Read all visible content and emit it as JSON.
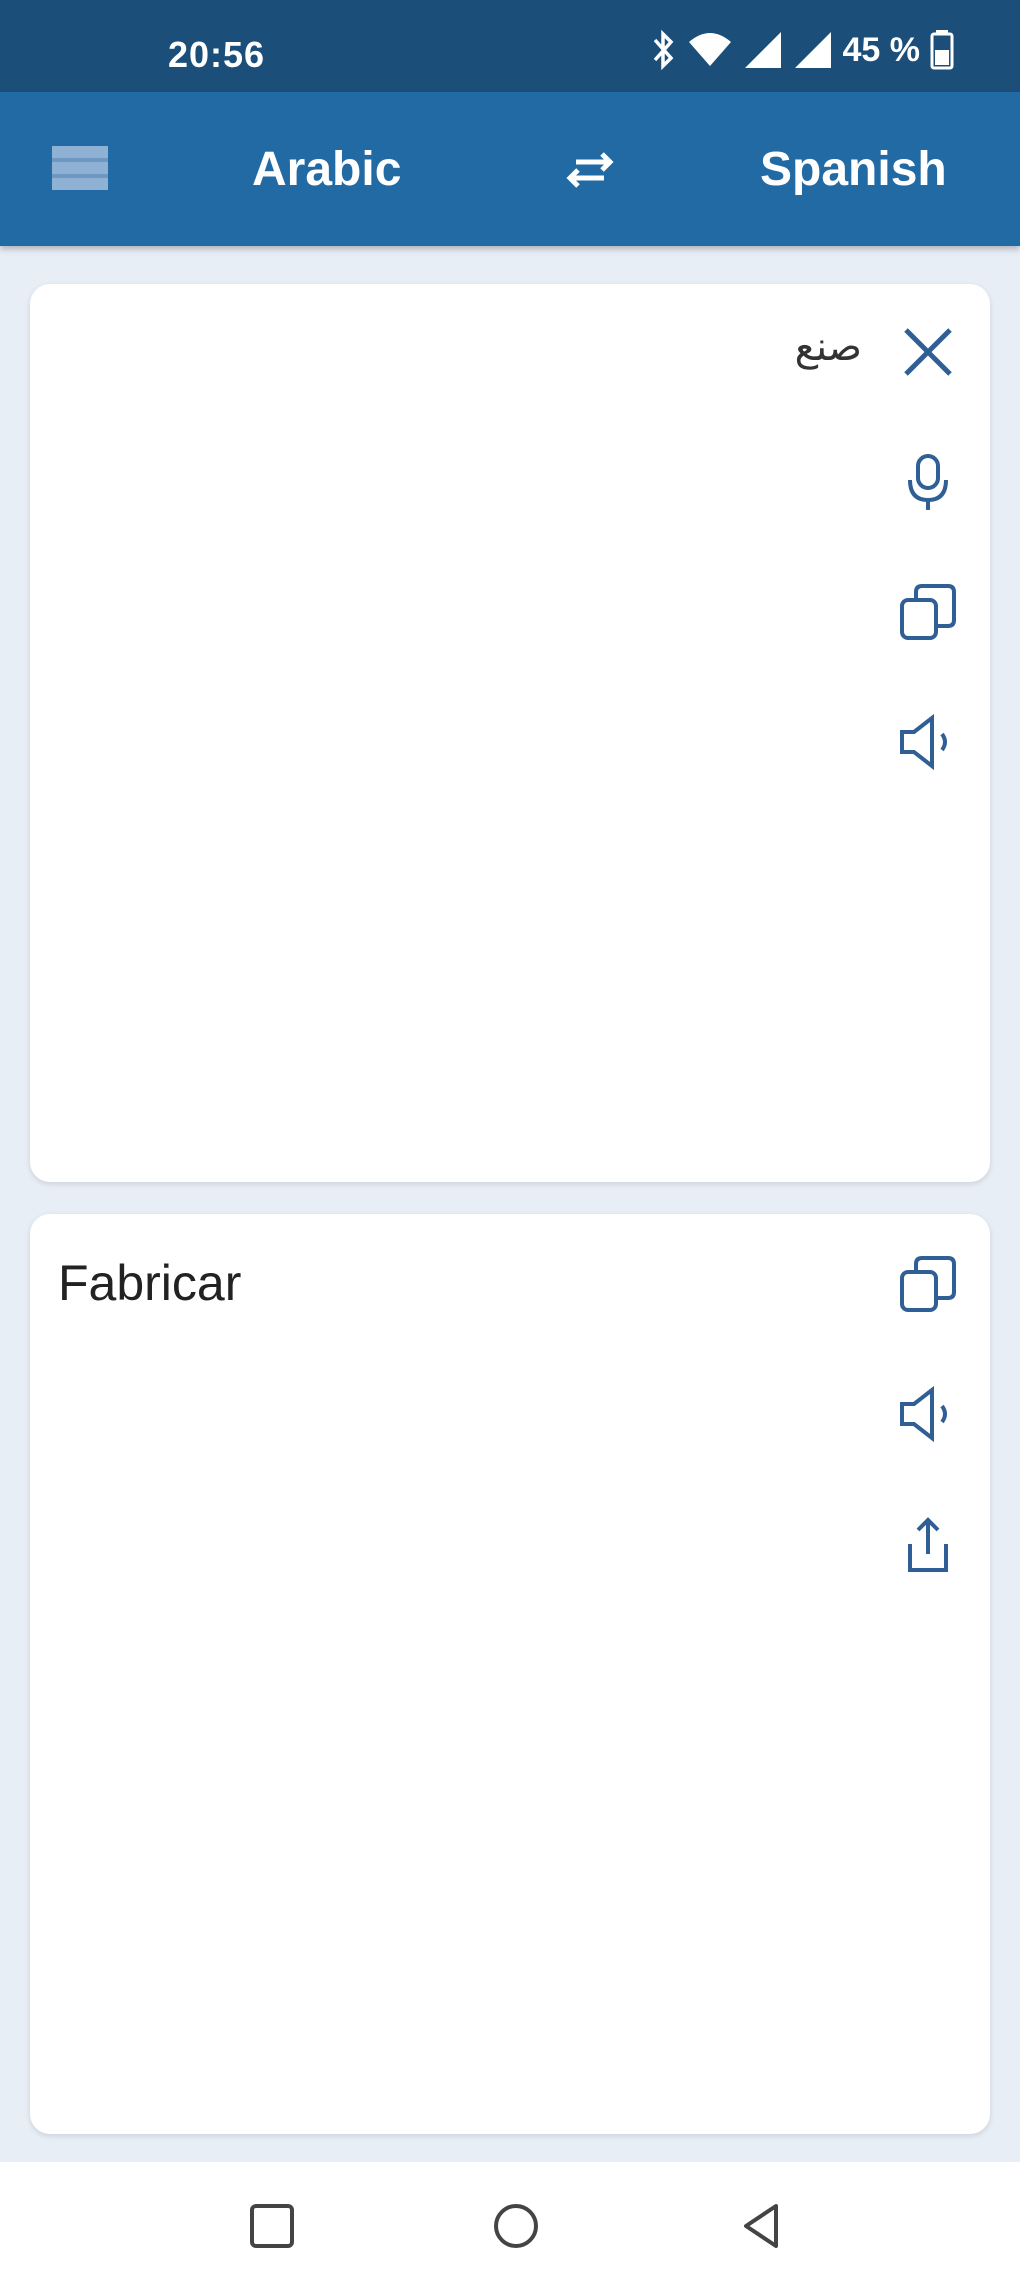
{
  "status_bar": {
    "time": "20:56",
    "battery": "45 %"
  },
  "app_bar": {
    "source_language": "Arabic",
    "target_language": "Spanish",
    "icons": [
      "menu-icon",
      "swap-icon"
    ]
  },
  "input_card": {
    "text": "صنع",
    "icons": [
      "close-icon",
      "microphone-icon",
      "copy-icon",
      "speaker-icon"
    ]
  },
  "output_card": {
    "text": "Fabricar",
    "icons": [
      "copy-icon",
      "speaker-icon",
      "share-icon"
    ]
  },
  "nav_bar": {
    "icons": [
      "recent-apps-icon",
      "home-icon",
      "back-icon"
    ]
  },
  "colors": {
    "status_bar": "#1b4f7a",
    "app_bar": "#226aa4",
    "background": "#e8eef6",
    "icon_accent": "#2f5f95"
  }
}
